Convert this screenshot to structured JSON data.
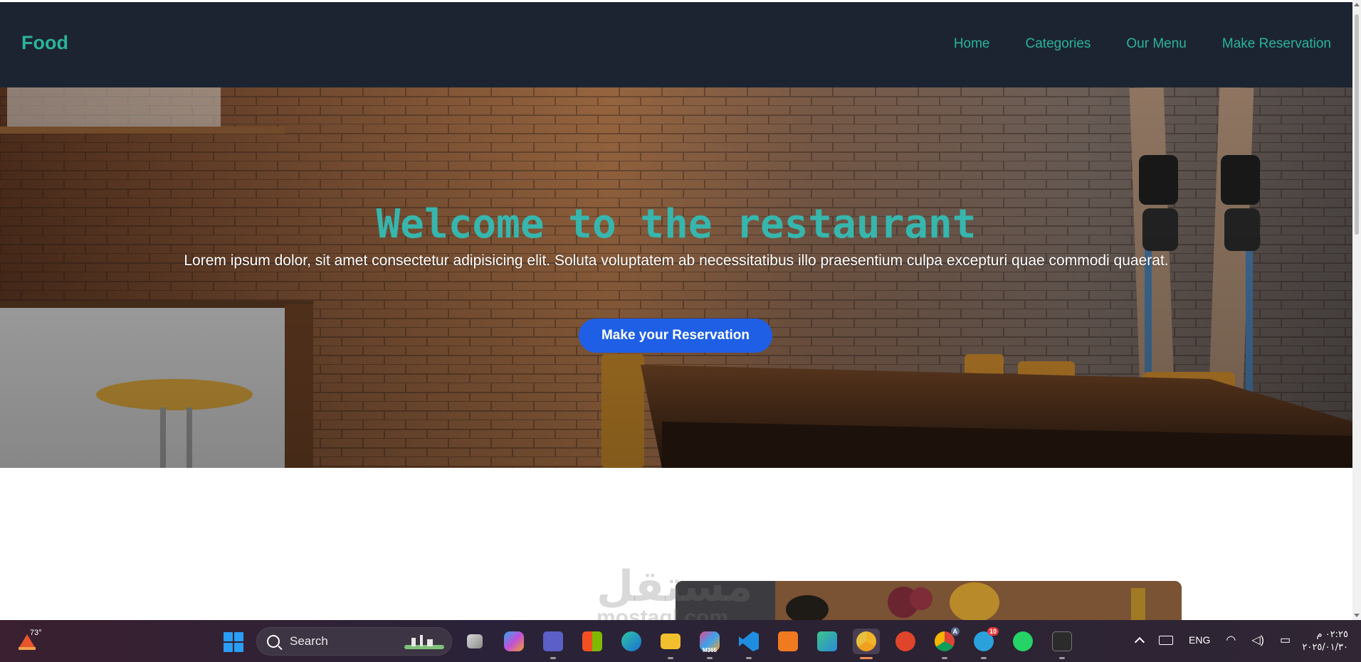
{
  "navbar": {
    "brand": "Food",
    "links": [
      "Home",
      "Categories",
      "Our Menu",
      "Make Reservation"
    ]
  },
  "hero": {
    "title": "Welcome to the restaurant",
    "subtitle": "Lorem ipsum dolor, sit amet consectetur adipisicing elit. Soluta voluptatem ab necessitatibus illo praesentium culpa excepturi quae commodi quaerat.",
    "button": "Make your Reservation"
  },
  "watermark": {
    "arabic": "مستقل",
    "latin": "mostaql.com"
  },
  "taskbar": {
    "weather_temp": "73°",
    "search_label": "Search",
    "apps": [
      {
        "icon": "task-view-icon"
      },
      {
        "icon": "copilot-icon"
      },
      {
        "icon": "teams-icon"
      },
      {
        "icon": "store-icon"
      },
      {
        "icon": "edge-icon"
      },
      {
        "icon": "file-explorer-icon"
      },
      {
        "icon": "m365-icon",
        "label": "M365"
      },
      {
        "icon": "vscode-icon"
      },
      {
        "icon": "xampp-icon"
      },
      {
        "icon": "app-green-icon"
      },
      {
        "icon": "chrome-canary-icon",
        "active": true
      },
      {
        "icon": "brave-icon"
      },
      {
        "icon": "chrome-icon",
        "label": "A"
      },
      {
        "icon": "telegram-icon",
        "badge": "10"
      },
      {
        "icon": "whatsapp-icon"
      },
      {
        "icon": "terminal-icon"
      }
    ],
    "tray": {
      "language": "ENG",
      "time": "٠٢:٢٥ م",
      "date": "٢٠٢٥/٠١/٣٠"
    }
  },
  "colors": {
    "nav_bg": "#1c2432",
    "accent": "#2bb39a",
    "button": "#1f5fe6"
  }
}
